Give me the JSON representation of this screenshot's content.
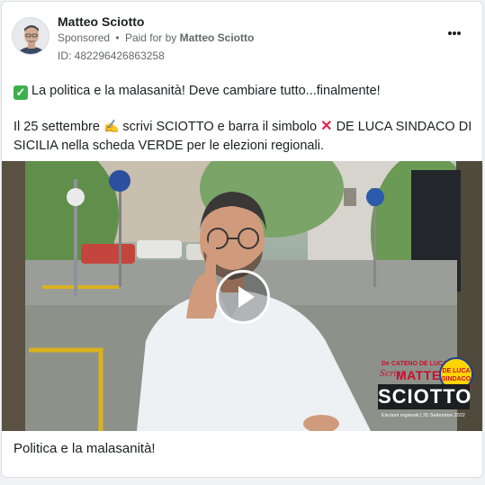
{
  "post": {
    "author": "Matteo Sciotto",
    "sponsored_label": "Sponsored",
    "separator": "•",
    "paid_prefix": "Paid for by",
    "paid_by": "Matteo Sciotto",
    "library_id": "ID: 482296426863258",
    "line1": "La politica e la malasanità! Deve cambiare tutto...finalmente!",
    "line2a": "Il 25 settembre",
    "line2b": "scrivi SCIOTTO e barra il simbolo",
    "line2c": "DE LUCA SINDACO DI SICILIA nella scheda VERDE per le elezioni regionali.",
    "caption": "Politica e la malasanità!"
  },
  "video_overlay": {
    "cateno": "De CATENO DE LUCA",
    "scrivi": "Scrivi",
    "matteo": "MATTEO",
    "sciotto": "SCIOTTO",
    "deluca_badge": "DE LUCA SINDACO DI SICILIA",
    "elezioni": "Elezioni regionali | 25 Settembre 2022"
  },
  "icons": {
    "check": "check-mark-emoji",
    "hand": "writing-hand-emoji",
    "cross": "cross-mark-emoji",
    "more": "more-options-icon",
    "play": "play-icon"
  },
  "colors": {
    "accent_red": "#c8102e",
    "badge_yellow": "#ffd400",
    "check_green": "#3cb14a"
  }
}
